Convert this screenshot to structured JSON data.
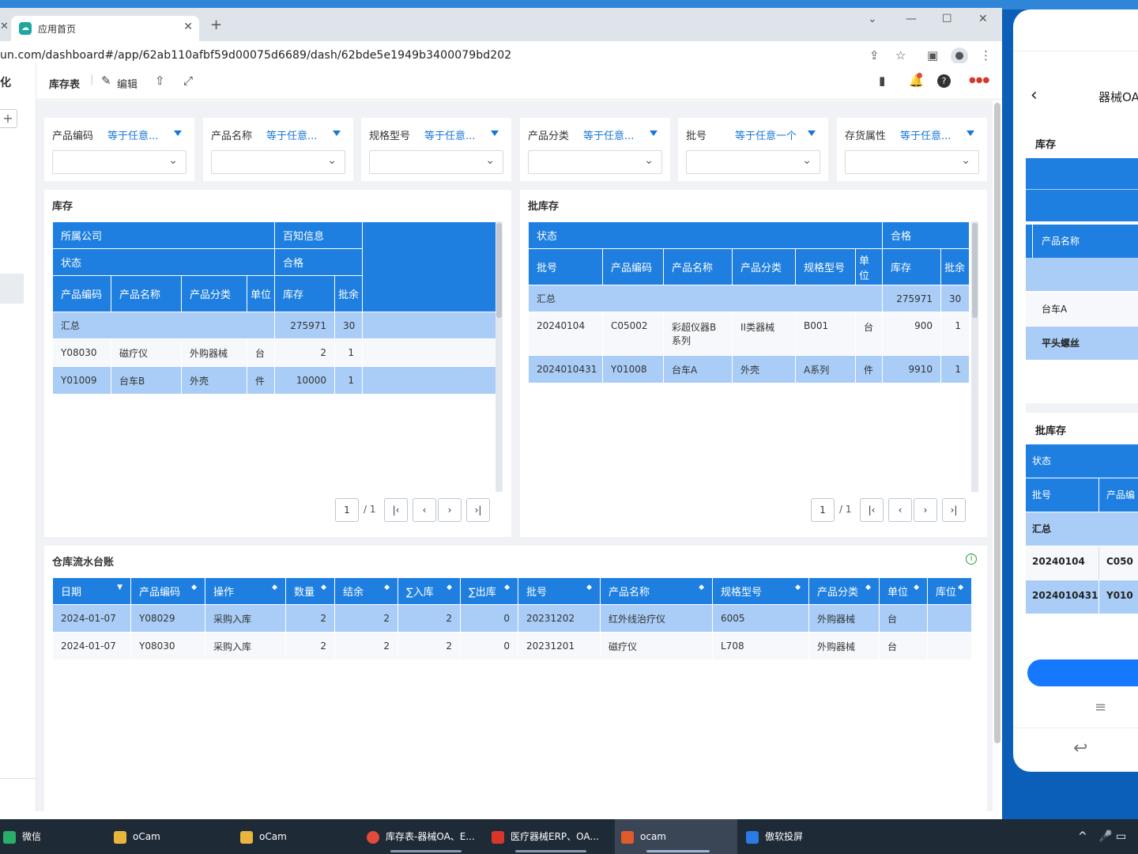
{
  "browser": {
    "tab_title": "应用首页",
    "url": "un.com/dashboard#/app/62ab110afbf59d00075d6689/dash/62bde5e1949b3400079bd202"
  },
  "leftnav": {
    "title": "化"
  },
  "toolbar": {
    "title": "库存表",
    "edit_label": "编辑"
  },
  "filters": [
    {
      "label": "产品编码",
      "op": "等于任意..."
    },
    {
      "label": "产品名称",
      "op": "等于任意..."
    },
    {
      "label": "规格型号",
      "op": "等于任意..."
    },
    {
      "label": "产品分类",
      "op": "等于任意..."
    },
    {
      "label": "批号",
      "op": "等于任意一个"
    },
    {
      "label": "存货属性",
      "op": "等于任意..."
    }
  ],
  "stock": {
    "title": "库存",
    "h_company": "所属公司",
    "h_company_val": "百知信息",
    "h_status": "状态",
    "h_status_val": "合格",
    "cols": [
      "产品编码",
      "产品名称",
      "产品分类",
      "单位",
      "库存",
      "批余"
    ],
    "summary": {
      "label": "汇总",
      "stock": "275971",
      "batch": "30"
    },
    "rows": [
      [
        "Y08030",
        "磁疗仪",
        "外购器械",
        "台",
        "2",
        "1"
      ],
      [
        "Y01009",
        "台车B",
        "外壳",
        "件",
        "10000",
        "1"
      ]
    ],
    "pager": {
      "page": "1",
      "total": "/ 1"
    }
  },
  "batch": {
    "title": "批库存",
    "h_status": "状态",
    "h_status_val": "合格",
    "cols": [
      "批号",
      "产品编码",
      "产品名称",
      "产品分类",
      "规格型号",
      "单位",
      "库存",
      "批余"
    ],
    "summary": {
      "label": "汇总",
      "stock": "275971",
      "batch": "30"
    },
    "rows": [
      [
        "20240104",
        "C05002",
        "彩超仪器B系列",
        "II类器械",
        "B001",
        "台",
        "900",
        "1"
      ],
      [
        "2024010431",
        "Y01008",
        "台车A",
        "外壳",
        "A系列",
        "件",
        "9910",
        "1"
      ]
    ],
    "pager": {
      "page": "1",
      "total": "/ 1"
    }
  },
  "ledger": {
    "title": "仓库流水台账",
    "cols": [
      "日期",
      "产品编码",
      "操作",
      "数量",
      "结余",
      "∑入库",
      "∑出库",
      "批号",
      "产品名称",
      "规格型号",
      "产品分类",
      "单位",
      "库位"
    ],
    "rows": [
      [
        "2024-01-07",
        "Y08029",
        "采购入库",
        "2",
        "2",
        "2",
        "0",
        "20231202",
        "红外线治疗仪",
        "6005",
        "外购器械",
        "台",
        ""
      ],
      [
        "2024-01-07",
        "Y08030",
        "采购入库",
        "2",
        "2",
        "2",
        "0",
        "20231201",
        "磁疗仪",
        "L708",
        "外购器械",
        "台",
        ""
      ]
    ]
  },
  "phone": {
    "title": "器械OA",
    "stock_title": "库存",
    "col_name": "产品名称",
    "stock_rows": [
      "台车A",
      "平头螺丝"
    ],
    "batch_title": "批库存",
    "status": "状态",
    "col_batch": "批号",
    "col_code": "产品编",
    "summary": "汇总",
    "batch_rows": [
      [
        "20240104",
        "C050"
      ],
      [
        "2024010431",
        "Y010"
      ]
    ]
  },
  "taskbar": [
    {
      "label": "微信",
      "color": "#2aae67"
    },
    {
      "label": "oCam",
      "color": "#e9b53c"
    },
    {
      "label": "oCam",
      "color": "#e9b53c"
    },
    {
      "label": "库存表-器械OA、E...",
      "color": "#e24a3b"
    },
    {
      "label": "医疗器械ERP、OA...",
      "color": "#d9362b"
    },
    {
      "label": "ocam",
      "color": "#e05a2b"
    },
    {
      "label": "傲软投屏",
      "color": "#2c7be5"
    }
  ]
}
